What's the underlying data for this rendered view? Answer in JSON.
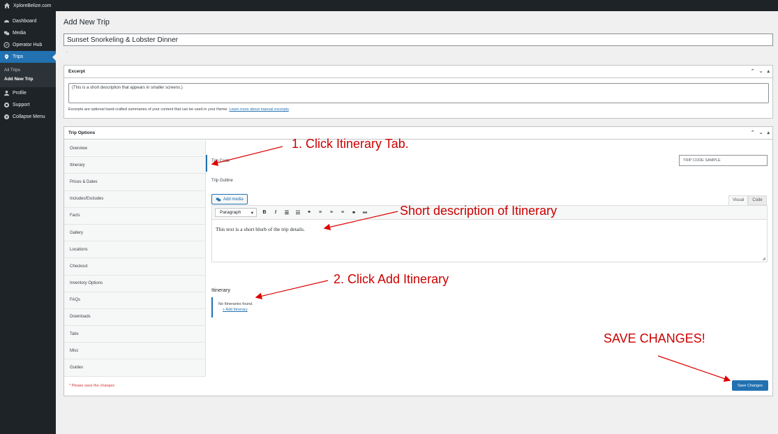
{
  "adminbar": {
    "site_name": "XploreBelize.com",
    "home_icon": "home-icon"
  },
  "sidebar": {
    "items": [
      {
        "label": "Dashboard",
        "icon": "dashboard-icon"
      },
      {
        "label": "Media",
        "icon": "media-icon"
      },
      {
        "label": "Operator Hub",
        "icon": "compass-icon"
      },
      {
        "label": "Trips",
        "icon": "location-pin-icon"
      },
      {
        "label": "Profile",
        "icon": "user-icon"
      },
      {
        "label": "Support",
        "icon": "support-icon"
      },
      {
        "label": "Collapse Menu",
        "icon": "collapse-icon"
      }
    ],
    "submenu": [
      {
        "label": "All Trips"
      },
      {
        "label": "Add New Trip"
      }
    ]
  },
  "page": {
    "title": "Add New Trip",
    "post_title": "Sunset Snorkeling & Lobster Dinner"
  },
  "excerpt": {
    "header": "Excerpt",
    "placeholder": "(This is a short description that appears in smaller screens.)",
    "help_text": "Excerpts are optional hand-crafted summaries of your content that can be used in your theme.",
    "help_link": "Learn more about manual excerpts"
  },
  "trip_options": {
    "header": "Trip Options",
    "tabs": [
      {
        "label": "Overview"
      },
      {
        "label": "Itinerary"
      },
      {
        "label": "Prices & Dates"
      },
      {
        "label": "Includes/Excludes"
      },
      {
        "label": "Facts"
      },
      {
        "label": "Gallery"
      },
      {
        "label": "Locations"
      },
      {
        "label": "Checkout"
      },
      {
        "label": "Inventory Options"
      },
      {
        "label": "FAQs"
      },
      {
        "label": "Downloads"
      },
      {
        "label": "Tabs"
      },
      {
        "label": "Misc"
      },
      {
        "label": "Guides"
      }
    ],
    "trip_code_label": "Trip Code",
    "trip_code_value": "TRIP CODE SAMPLE",
    "trip_outline_label": "Trip Outline",
    "add_media_label": "Add media",
    "editor_tabs": {
      "visual": "Visual",
      "code": "Code"
    },
    "format_select": "Paragraph",
    "editor_content": "This text is a short blurb of the trip details.",
    "itinerary_heading": "Itinerary",
    "no_itineraries": "No Itineraries found.",
    "add_itinerary": "+ Add Itinerary",
    "footer_note": "* Please save the changes",
    "save_button": "Save Changes"
  },
  "annotations": {
    "step1": "1.  Click Itinerary Tab.",
    "short_desc": "Short description of Itinerary",
    "step2": "2. Click Add Itinerary",
    "save": "SAVE CHANGES!"
  },
  "colors": {
    "accent": "#2271b1",
    "annotation": "#cc0000",
    "sidebar": "#1d2327"
  }
}
